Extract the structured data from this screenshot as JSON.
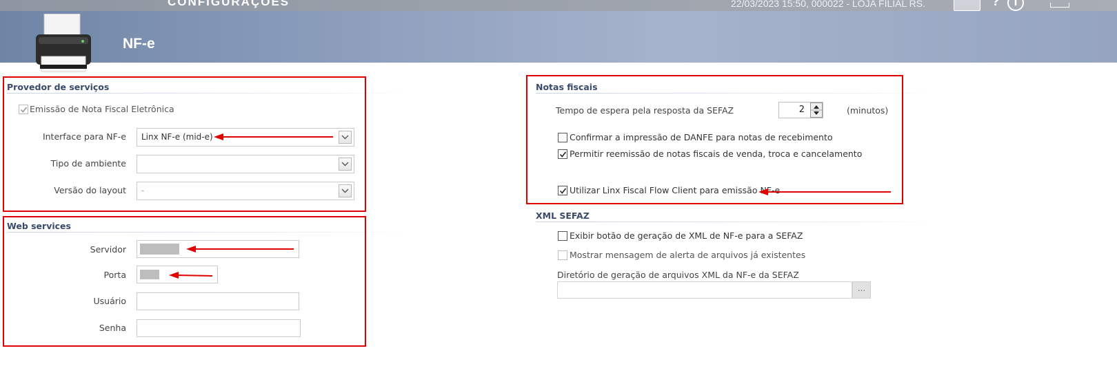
{
  "topbar": {
    "title": "CONFIGURAÇÕES",
    "info": "22/03/2023 15:50, 000022 - LOJA FILIAL RS.",
    "help_label": "?",
    "info_icon_label": "i"
  },
  "header": {
    "page_title": "NF-e"
  },
  "provedor": {
    "title": "Provedor de serviços",
    "emissao_label": "Emissão de Nota Fiscal Eletrônica",
    "emissao_checked": true,
    "interface_label": "Interface para NF-e",
    "interface_value": "Linx NF-e (mid-e)",
    "ambiente_label": "Tipo de ambiente",
    "ambiente_value": "",
    "versao_label": "Versão do layout",
    "versao_value": "-"
  },
  "web_services": {
    "title": "Web services",
    "servidor_label": "Servidor",
    "porta_label": "Porta",
    "usuario_label": "Usuário",
    "senha_label": "Senha"
  },
  "notas": {
    "title": "Notas fiscais",
    "tempo_label": "Tempo de espera pela resposta da SEFAZ",
    "tempo_value": "2",
    "tempo_unit": "(minutos)",
    "confirmar_label": "Confirmar a impressão de DANFE para notas de recebimento",
    "confirmar_checked": false,
    "permitir_label": "Permitir reemissão de notas fiscais de venda, troca e cancelamento",
    "permitir_checked": true,
    "utilizar_label": "Utilizar Linx Fiscal Flow Client para emissão NF-e",
    "utilizar_checked": true
  },
  "xml": {
    "title": "XML SEFAZ",
    "exibir_label": "Exibir botão de geração de XML de NF-e para a SEFAZ",
    "exibir_checked": false,
    "mostrar_label": "Mostrar mensagem de alerta de arquivos já existentes",
    "mostrar_checked": false,
    "diretorio_label": "Diretório de geração de arquivos XML da NF-e da SEFAZ",
    "diretorio_value": "",
    "browse_label": "..."
  },
  "colors": {
    "highlight": "#e00000",
    "header": "#8c9dbc",
    "section_title": "#3a4a6a"
  }
}
